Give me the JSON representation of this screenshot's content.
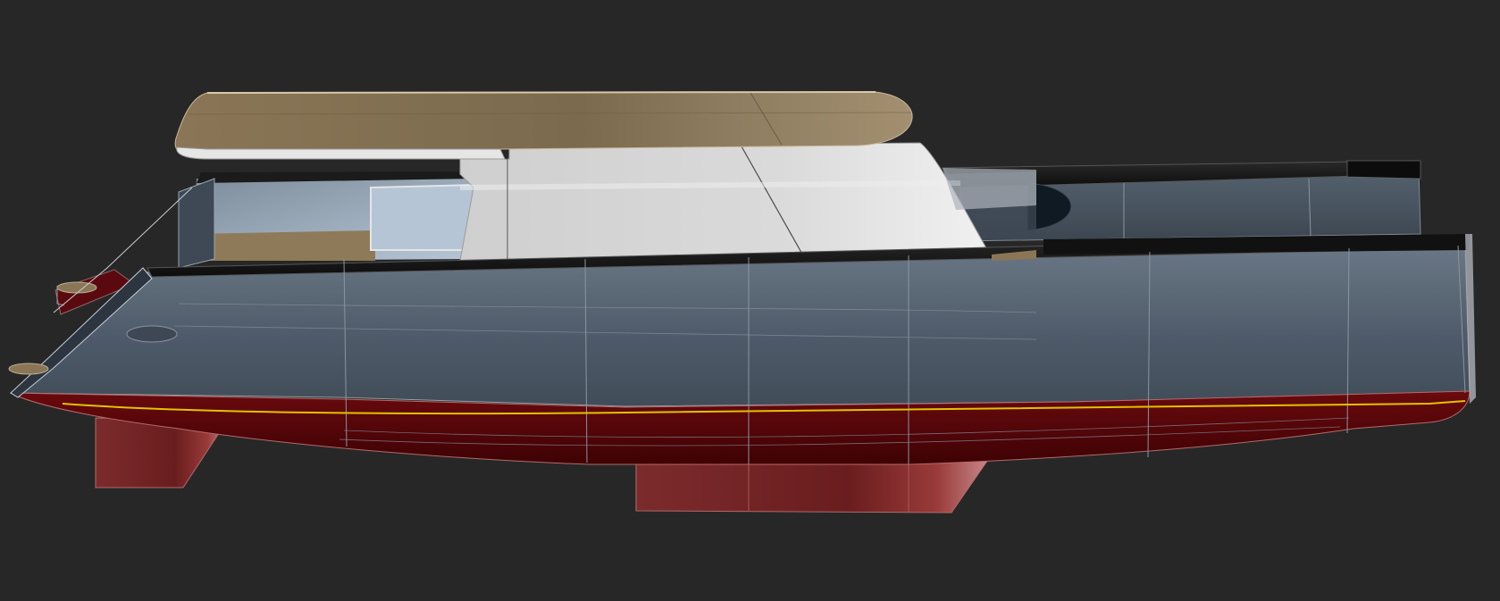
{
  "scene": {
    "subject": "catamaran-hull-render",
    "view": "side-perspective",
    "colors": {
      "background": "#272727",
      "hull_glass": "#5a6878",
      "antifouling": "#5a0508",
      "keel": "#7a2a2a",
      "hardtop_deck": "#8a7656",
      "superstructure": "#dcdcdc",
      "rail": "#141414",
      "waterline": "#e2c200",
      "edge": "#9aa3ad"
    },
    "parts": [
      "hull-port",
      "hull-starboard",
      "bridgedeck",
      "hardtop",
      "cabin",
      "keel-fwd",
      "keel-aft",
      "waterline"
    ]
  }
}
